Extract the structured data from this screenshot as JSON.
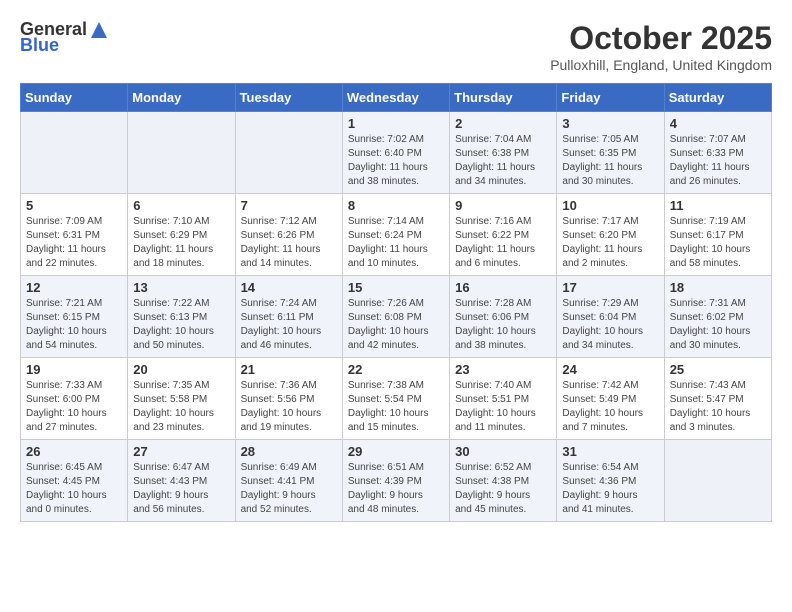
{
  "header": {
    "logo_line1": "General",
    "logo_line2": "Blue",
    "month_title": "October 2025",
    "subtitle": "Pulloxhill, England, United Kingdom"
  },
  "weekdays": [
    "Sunday",
    "Monday",
    "Tuesday",
    "Wednesday",
    "Thursday",
    "Friday",
    "Saturday"
  ],
  "weeks": [
    [
      {
        "day": "",
        "info": ""
      },
      {
        "day": "",
        "info": ""
      },
      {
        "day": "",
        "info": ""
      },
      {
        "day": "1",
        "info": "Sunrise: 7:02 AM\nSunset: 6:40 PM\nDaylight: 11 hours\nand 38 minutes."
      },
      {
        "day": "2",
        "info": "Sunrise: 7:04 AM\nSunset: 6:38 PM\nDaylight: 11 hours\nand 34 minutes."
      },
      {
        "day": "3",
        "info": "Sunrise: 7:05 AM\nSunset: 6:35 PM\nDaylight: 11 hours\nand 30 minutes."
      },
      {
        "day": "4",
        "info": "Sunrise: 7:07 AM\nSunset: 6:33 PM\nDaylight: 11 hours\nand 26 minutes."
      }
    ],
    [
      {
        "day": "5",
        "info": "Sunrise: 7:09 AM\nSunset: 6:31 PM\nDaylight: 11 hours\nand 22 minutes."
      },
      {
        "day": "6",
        "info": "Sunrise: 7:10 AM\nSunset: 6:29 PM\nDaylight: 11 hours\nand 18 minutes."
      },
      {
        "day": "7",
        "info": "Sunrise: 7:12 AM\nSunset: 6:26 PM\nDaylight: 11 hours\nand 14 minutes."
      },
      {
        "day": "8",
        "info": "Sunrise: 7:14 AM\nSunset: 6:24 PM\nDaylight: 11 hours\nand 10 minutes."
      },
      {
        "day": "9",
        "info": "Sunrise: 7:16 AM\nSunset: 6:22 PM\nDaylight: 11 hours\nand 6 minutes."
      },
      {
        "day": "10",
        "info": "Sunrise: 7:17 AM\nSunset: 6:20 PM\nDaylight: 11 hours\nand 2 minutes."
      },
      {
        "day": "11",
        "info": "Sunrise: 7:19 AM\nSunset: 6:17 PM\nDaylight: 10 hours\nand 58 minutes."
      }
    ],
    [
      {
        "day": "12",
        "info": "Sunrise: 7:21 AM\nSunset: 6:15 PM\nDaylight: 10 hours\nand 54 minutes."
      },
      {
        "day": "13",
        "info": "Sunrise: 7:22 AM\nSunset: 6:13 PM\nDaylight: 10 hours\nand 50 minutes."
      },
      {
        "day": "14",
        "info": "Sunrise: 7:24 AM\nSunset: 6:11 PM\nDaylight: 10 hours\nand 46 minutes."
      },
      {
        "day": "15",
        "info": "Sunrise: 7:26 AM\nSunset: 6:08 PM\nDaylight: 10 hours\nand 42 minutes."
      },
      {
        "day": "16",
        "info": "Sunrise: 7:28 AM\nSunset: 6:06 PM\nDaylight: 10 hours\nand 38 minutes."
      },
      {
        "day": "17",
        "info": "Sunrise: 7:29 AM\nSunset: 6:04 PM\nDaylight: 10 hours\nand 34 minutes."
      },
      {
        "day": "18",
        "info": "Sunrise: 7:31 AM\nSunset: 6:02 PM\nDaylight: 10 hours\nand 30 minutes."
      }
    ],
    [
      {
        "day": "19",
        "info": "Sunrise: 7:33 AM\nSunset: 6:00 PM\nDaylight: 10 hours\nand 27 minutes."
      },
      {
        "day": "20",
        "info": "Sunrise: 7:35 AM\nSunset: 5:58 PM\nDaylight: 10 hours\nand 23 minutes."
      },
      {
        "day": "21",
        "info": "Sunrise: 7:36 AM\nSunset: 5:56 PM\nDaylight: 10 hours\nand 19 minutes."
      },
      {
        "day": "22",
        "info": "Sunrise: 7:38 AM\nSunset: 5:54 PM\nDaylight: 10 hours\nand 15 minutes."
      },
      {
        "day": "23",
        "info": "Sunrise: 7:40 AM\nSunset: 5:51 PM\nDaylight: 10 hours\nand 11 minutes."
      },
      {
        "day": "24",
        "info": "Sunrise: 7:42 AM\nSunset: 5:49 PM\nDaylight: 10 hours\nand 7 minutes."
      },
      {
        "day": "25",
        "info": "Sunrise: 7:43 AM\nSunset: 5:47 PM\nDaylight: 10 hours\nand 3 minutes."
      }
    ],
    [
      {
        "day": "26",
        "info": "Sunrise: 6:45 AM\nSunset: 4:45 PM\nDaylight: 10 hours\nand 0 minutes."
      },
      {
        "day": "27",
        "info": "Sunrise: 6:47 AM\nSunset: 4:43 PM\nDaylight: 9 hours\nand 56 minutes."
      },
      {
        "day": "28",
        "info": "Sunrise: 6:49 AM\nSunset: 4:41 PM\nDaylight: 9 hours\nand 52 minutes."
      },
      {
        "day": "29",
        "info": "Sunrise: 6:51 AM\nSunset: 4:39 PM\nDaylight: 9 hours\nand 48 minutes."
      },
      {
        "day": "30",
        "info": "Sunrise: 6:52 AM\nSunset: 4:38 PM\nDaylight: 9 hours\nand 45 minutes."
      },
      {
        "day": "31",
        "info": "Sunrise: 6:54 AM\nSunset: 4:36 PM\nDaylight: 9 hours\nand 41 minutes."
      },
      {
        "day": "",
        "info": ""
      }
    ]
  ]
}
